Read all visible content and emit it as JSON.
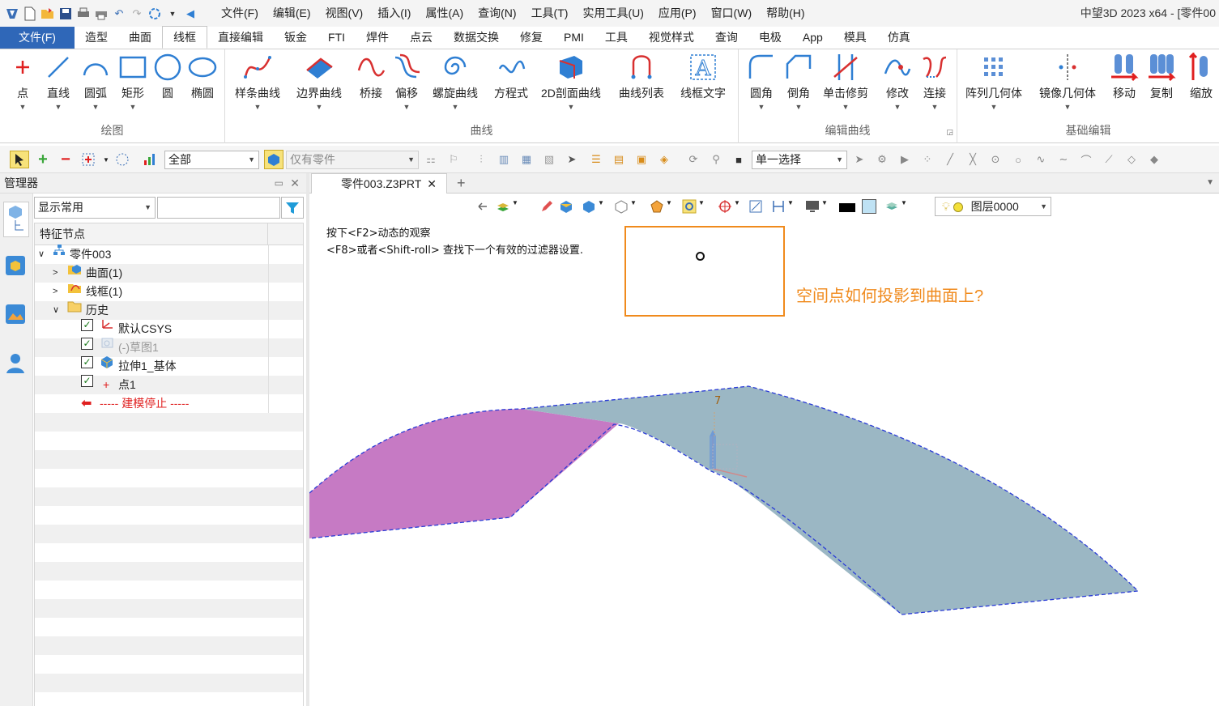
{
  "window": {
    "title": "中望3D 2023 x64 - [零件00"
  },
  "menubar": [
    "文件(F)",
    "编辑(E)",
    "视图(V)",
    "插入(I)",
    "属性(A)",
    "查询(N)",
    "工具(T)",
    "实用工具(U)",
    "应用(P)",
    "窗口(W)",
    "帮助(H)"
  ],
  "ribbon_tabs": [
    "文件(F)",
    "造型",
    "曲面",
    "线框",
    "直接编辑",
    "钣金",
    "FTI",
    "焊件",
    "点云",
    "数据交换",
    "修复",
    "PMI",
    "工具",
    "视觉样式",
    "查询",
    "电极",
    "App",
    "模具",
    "仿真"
  ],
  "active_tab": "线框",
  "groups": {
    "draw": {
      "title": "绘图",
      "buttons": [
        "点",
        "直线",
        "圆弧",
        "矩形",
        "圆",
        "椭圆"
      ]
    },
    "curve": {
      "title": "曲线",
      "buttons": [
        "样条曲线",
        "边界曲线",
        "桥接",
        "偏移",
        "螺旋曲线",
        "方程式",
        "2D剖面曲线",
        "曲线列表",
        "线框文字"
      ]
    },
    "edit": {
      "title": "编辑曲线",
      "buttons": [
        "圆角",
        "倒角",
        "单击修剪",
        "修改",
        "连接"
      ]
    },
    "basic": {
      "title": "基础编辑",
      "buttons": [
        "阵列几何体",
        "镜像几何体",
        "移动",
        "复制",
        "缩放"
      ]
    }
  },
  "toolbar": {
    "filter_value": "全部",
    "scope_value": "仅有零件",
    "select_mode": "单一选择"
  },
  "manager": {
    "title": "管理器",
    "display_combo": "显示常用",
    "search_value": "",
    "tree_header": "特征节点",
    "nodes": {
      "root": "零件003",
      "surface": "曲面(1)",
      "wireframe": "线框(1)",
      "history": "历史",
      "csys": "默认CSYS",
      "sketch": "(-)草图1",
      "extrude": "拉伸1_基体",
      "point": "点1",
      "stop": "----- 建模停止 -----"
    }
  },
  "document": {
    "tab_label": "零件003.Z3PRT"
  },
  "viewport": {
    "hint_line1": "按下<F2>动态的观察",
    "hint_line2": "<F8>或者<Shift-roll> 查找下一个有效的过滤器设置.",
    "layer": "图层0000",
    "annotation": "空间点如何投影到曲面上?",
    "colors": {
      "annotation": "#f08a1c",
      "surface_blue": "#9bb7c4",
      "surface_magenta": "#c67ac4",
      "edge": "#2a3bd6"
    }
  }
}
